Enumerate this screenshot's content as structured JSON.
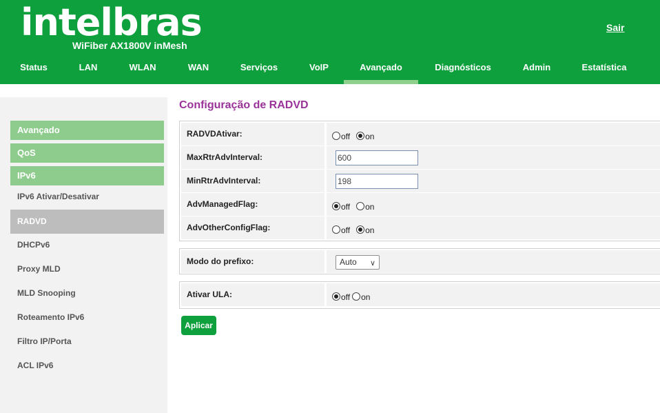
{
  "header": {
    "logo": "intelbras",
    "product": "WiFiber AX1800V inMesh",
    "logout": "Sair"
  },
  "nav": {
    "tabs": [
      {
        "label": "Status"
      },
      {
        "label": "LAN"
      },
      {
        "label": "WLAN"
      },
      {
        "label": "WAN"
      },
      {
        "label": "Serviços"
      },
      {
        "label": "VoIP"
      },
      {
        "label": "Avançado",
        "active": true
      },
      {
        "label": "Diagnósticos"
      },
      {
        "label": "Admin"
      },
      {
        "label": "Estatística"
      }
    ]
  },
  "sidebar": {
    "groups": [
      {
        "label": "Avançado"
      },
      {
        "label": "QoS"
      },
      {
        "label": "IPv6"
      }
    ],
    "items": [
      {
        "label": "IPv6 Ativar/Desativar"
      },
      {
        "label": "RADVD",
        "active": true
      },
      {
        "label": "DHCPv6"
      },
      {
        "label": "Proxy MLD"
      },
      {
        "label": "MLD Snooping"
      },
      {
        "label": "Roteamento IPv6"
      },
      {
        "label": "Filtro IP/Porta"
      },
      {
        "label": "ACL IPv6"
      }
    ]
  },
  "main": {
    "title": "Configuração de RADVD",
    "rows": {
      "radvd_enable": {
        "label": "RADVDAtivar:",
        "off": "off",
        "on": "on",
        "selected": "on"
      },
      "max_interval": {
        "label": "MaxRtrAdvInterval:",
        "value": "600"
      },
      "min_interval": {
        "label": "MinRtrAdvInterval:",
        "value": "198"
      },
      "managed_flag": {
        "label": "AdvManagedFlag:",
        "off": "off",
        "on": "on",
        "selected": "off"
      },
      "other_flag": {
        "label": "AdvOtherConfigFlag:",
        "off": "off",
        "on": "on",
        "selected": "on"
      },
      "prefix_mode": {
        "label": "Modo do prefixo:",
        "value": "Auto"
      },
      "ula_enable": {
        "label": "Ativar ULA:",
        "off": "off",
        "on": "on",
        "selected": "off"
      }
    },
    "apply_label": "Aplicar"
  },
  "colors": {
    "brand_green": "#0ea03c",
    "sidebar_green": "#8dcc8d",
    "title_purple": "#993399"
  }
}
